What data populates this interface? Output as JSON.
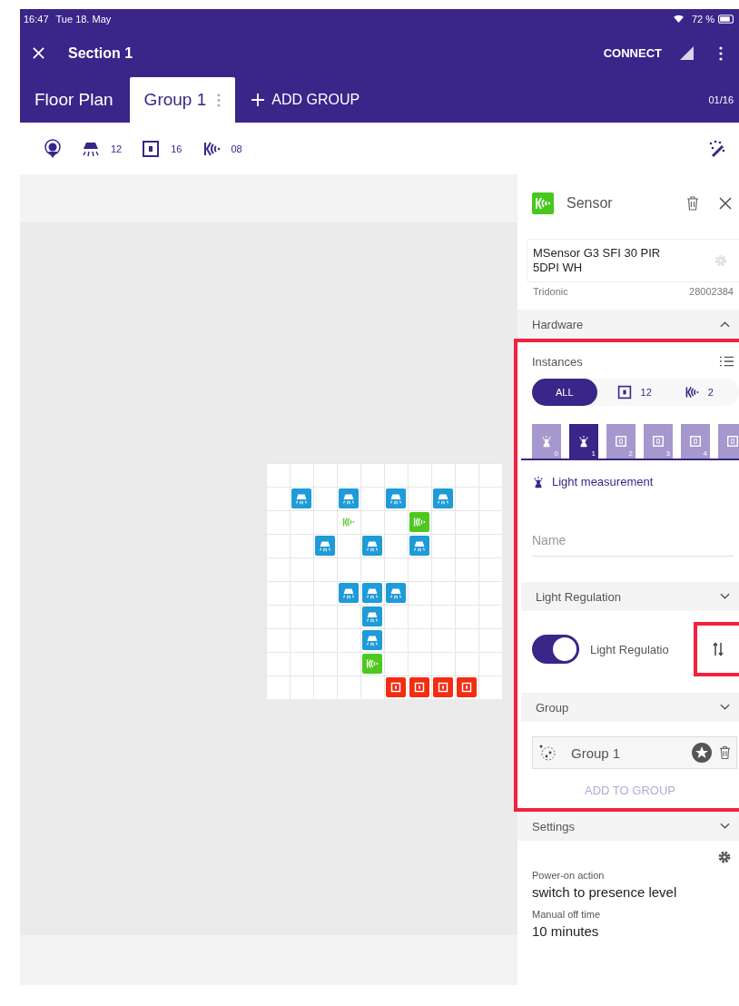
{
  "status_bar": {
    "time": "16:47",
    "date": "Tue 18. May",
    "battery": "72 %"
  },
  "app_bar": {
    "title": "Section 1",
    "connect": "CONNECT"
  },
  "tabs": [
    {
      "label": "Floor Plan",
      "selected": false,
      "menu": false
    },
    {
      "label": "Group 1",
      "selected": true,
      "menu": true
    }
  ],
  "add_group": "ADD GROUP",
  "page_counter": "01/16",
  "toolbar_counts": [
    {
      "kind": "light",
      "count": "12"
    },
    {
      "kind": "switch",
      "count": "16"
    },
    {
      "kind": "sensor",
      "count": "08"
    }
  ],
  "floor_plan": {
    "grid_rows": [
      {
        "cells": [
          {
            "kind": "empty"
          },
          {
            "kind": "empty"
          },
          {
            "kind": "empty"
          },
          {
            "kind": "empty"
          },
          {
            "kind": "empty"
          },
          {
            "kind": "empty"
          },
          {
            "kind": "empty"
          },
          {
            "kind": "empty"
          },
          {
            "kind": "empty"
          },
          {
            "kind": "empty"
          }
        ]
      },
      {
        "cells": [
          {
            "kind": "empty"
          },
          {
            "kind": "light"
          },
          {
            "kind": "empty"
          },
          {
            "kind": "light"
          },
          {
            "kind": "empty"
          },
          {
            "kind": "light"
          },
          {
            "kind": "empty"
          },
          {
            "kind": "light"
          },
          {
            "kind": "empty"
          },
          {
            "kind": "empty"
          }
        ]
      },
      {
        "cells": [
          {
            "kind": "empty"
          },
          {
            "kind": "empty"
          },
          {
            "kind": "empty"
          },
          {
            "kind": "sensor-ghost"
          },
          {
            "kind": "empty"
          },
          {
            "kind": "empty"
          },
          {
            "kind": "sensor"
          },
          {
            "kind": "empty"
          },
          {
            "kind": "empty"
          },
          {
            "kind": "empty"
          }
        ]
      },
      {
        "cells": [
          {
            "kind": "empty"
          },
          {
            "kind": "empty"
          },
          {
            "kind": "light"
          },
          {
            "kind": "empty"
          },
          {
            "kind": "light"
          },
          {
            "kind": "empty"
          },
          {
            "kind": "light"
          },
          {
            "kind": "empty"
          },
          {
            "kind": "empty"
          },
          {
            "kind": "empty"
          }
        ]
      },
      {
        "cells": [
          {
            "kind": "empty"
          },
          {
            "kind": "empty"
          },
          {
            "kind": "empty"
          },
          {
            "kind": "empty"
          },
          {
            "kind": "empty"
          },
          {
            "kind": "empty"
          },
          {
            "kind": "empty"
          },
          {
            "kind": "empty"
          },
          {
            "kind": "empty"
          },
          {
            "kind": "empty"
          }
        ]
      },
      {
        "cells": [
          {
            "kind": "empty"
          },
          {
            "kind": "empty"
          },
          {
            "kind": "empty"
          },
          {
            "kind": "light"
          },
          {
            "kind": "light"
          },
          {
            "kind": "light"
          },
          {
            "kind": "empty"
          },
          {
            "kind": "empty"
          },
          {
            "kind": "empty"
          },
          {
            "kind": "empty"
          }
        ]
      },
      {
        "cells": [
          {
            "kind": "empty"
          },
          {
            "kind": "empty"
          },
          {
            "kind": "empty"
          },
          {
            "kind": "empty"
          },
          {
            "kind": "light"
          },
          {
            "kind": "empty"
          },
          {
            "kind": "empty"
          },
          {
            "kind": "empty"
          },
          {
            "kind": "empty"
          },
          {
            "kind": "empty"
          }
        ]
      },
      {
        "cells": [
          {
            "kind": "empty"
          },
          {
            "kind": "empty"
          },
          {
            "kind": "empty"
          },
          {
            "kind": "empty"
          },
          {
            "kind": "light"
          },
          {
            "kind": "empty"
          },
          {
            "kind": "empty"
          },
          {
            "kind": "empty"
          },
          {
            "kind": "empty"
          },
          {
            "kind": "empty"
          }
        ]
      },
      {
        "cells": [
          {
            "kind": "empty"
          },
          {
            "kind": "empty"
          },
          {
            "kind": "empty"
          },
          {
            "kind": "empty"
          },
          {
            "kind": "sensor"
          },
          {
            "kind": "empty"
          },
          {
            "kind": "empty"
          },
          {
            "kind": "empty"
          },
          {
            "kind": "empty"
          },
          {
            "kind": "empty"
          }
        ]
      },
      {
        "cells": [
          {
            "kind": "empty"
          },
          {
            "kind": "empty"
          },
          {
            "kind": "empty"
          },
          {
            "kind": "empty"
          },
          {
            "kind": "empty"
          },
          {
            "kind": "switch"
          },
          {
            "kind": "switch"
          },
          {
            "kind": "switch"
          },
          {
            "kind": "switch"
          },
          {
            "kind": "empty"
          }
        ]
      }
    ]
  },
  "panel": {
    "title": "Sensor",
    "product": "MSensor G3 SFI 30 PIR 5DPI WH",
    "manufacturer": "Tridonic",
    "article": "28002384",
    "hardware": {
      "title": "Hardware",
      "expanded": true
    },
    "instances_title": "Instances",
    "filters": [
      {
        "kind": "all",
        "label": "ALL",
        "selected": true
      },
      {
        "kind": "switch",
        "label": "12",
        "selected": false
      },
      {
        "kind": "sensor",
        "label": "2",
        "selected": false
      }
    ],
    "instance_tiles": [
      {
        "kind": "light-sensor",
        "number": "0",
        "selected": false
      },
      {
        "kind": "light-sensor",
        "number": "1",
        "selected": true
      },
      {
        "kind": "switch",
        "number": "2",
        "selected": false
      },
      {
        "kind": "switch",
        "number": "3",
        "selected": false
      },
      {
        "kind": "switch",
        "number": "4",
        "selected": false
      },
      {
        "kind": "switch",
        "selected": false
      }
    ],
    "instance_type": "Light measurement",
    "name_placeholder": "Name",
    "light_regulation": {
      "title": "Light Regulation",
      "label": "Light Regulatio",
      "on": true
    },
    "group": {
      "title": "Group",
      "name": "Group 1",
      "add": "ADD TO GROUP"
    },
    "settings": {
      "title": "Settings",
      "fields": [
        {
          "label": "Power-on action",
          "value": "switch to presence level"
        },
        {
          "label": "Manual off time",
          "value": "10 minutes"
        }
      ]
    }
  }
}
